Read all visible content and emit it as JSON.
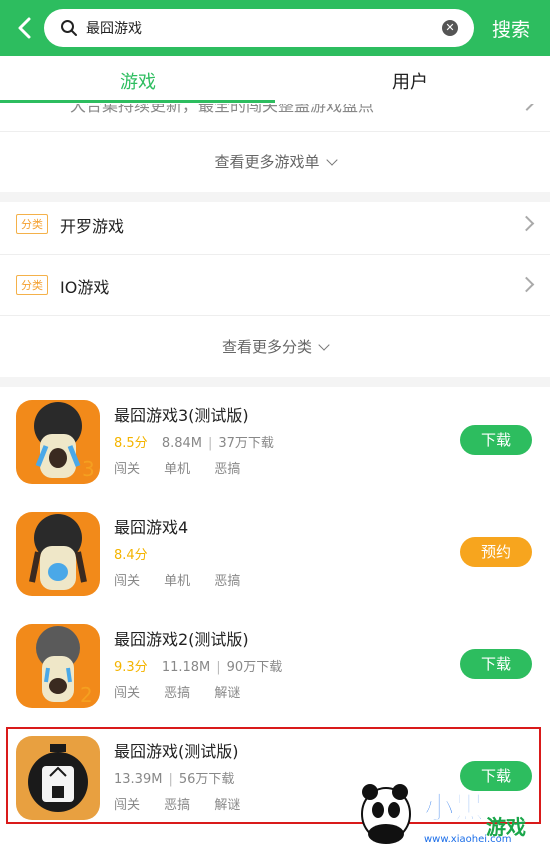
{
  "header": {
    "search_value": "最囧游戏",
    "search_button": "搜索"
  },
  "tabs": [
    {
      "label": "游戏",
      "active": true
    },
    {
      "label": "用户",
      "active": false
    }
  ],
  "partial_row_text": "大合集持续更新，最全的闯关整蛊游戏盘点",
  "more_lists": "查看更多游戏单",
  "categories": [
    {
      "badge": "分类",
      "label": "开罗游戏"
    },
    {
      "badge": "分类",
      "label": "IO游戏"
    }
  ],
  "more_categories": "查看更多分类",
  "games": [
    {
      "title": "最囧游戏3(测试版)",
      "score": "8.5分",
      "size": "8.84M",
      "downloads": "37万下载",
      "tags": [
        "闯关",
        "单机",
        "恶搞"
      ],
      "action": "下载",
      "action_color": "#2dbd5f"
    },
    {
      "title": "最囧游戏4",
      "score": "8.4分",
      "size": "",
      "downloads": "",
      "tags": [
        "闯关",
        "单机",
        "恶搞"
      ],
      "action": "预约",
      "action_color": "#f7a51e"
    },
    {
      "title": "最囧游戏2(测试版)",
      "score": "9.3分",
      "size": "11.18M",
      "downloads": "90万下载",
      "tags": [
        "闯关",
        "恶搞",
        "解谜"
      ],
      "action": "下载",
      "action_color": "#2dbd5f"
    },
    {
      "title": "最囧游戏(测试版)",
      "score": "",
      "size": "13.39M",
      "downloads": "56万下载",
      "tags": [
        "闯关",
        "恶搞",
        "解谜"
      ],
      "action": "下载",
      "action_color": "#2dbd5f"
    }
  ],
  "watermark": {
    "brand": "小黑游戏",
    "url": "www.xiaohei.com"
  },
  "colors": {
    "brand_green": "#2dbd5f",
    "highlight_red": "#d91a1a"
  }
}
